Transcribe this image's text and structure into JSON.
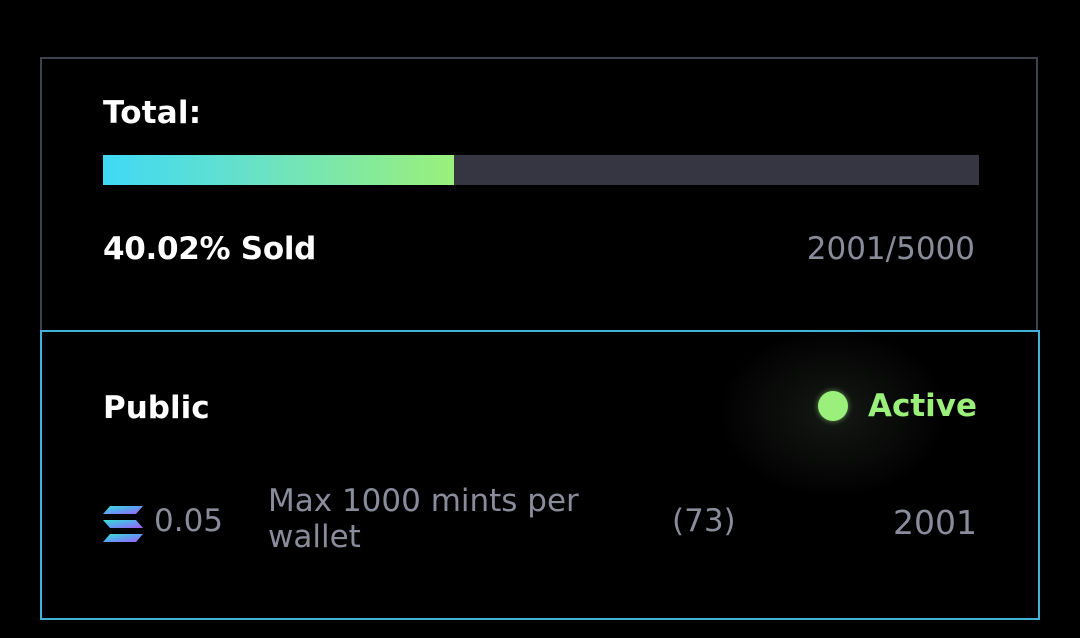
{
  "total": {
    "title": "Total:",
    "progress_fraction": 0.4002,
    "sold_label": "40.02% Sold",
    "sold_count": "2001/5000"
  },
  "phase": {
    "title": "Public",
    "status": "Active",
    "price": "0.05",
    "currency_icon": "solana-icon",
    "limit_text": "Max 1000 mints per wallet",
    "wallet_count": "(73)",
    "minted": "2001"
  },
  "colors": {
    "background": "#000000",
    "progress_start": "#3fd9f6",
    "progress_end": "#9af07a",
    "progress_track": "#353641",
    "active_green": "#9af07a",
    "muted_text": "#8a8b9b",
    "phase_border": "#3fb3d8",
    "card_border": "#3d4150"
  }
}
